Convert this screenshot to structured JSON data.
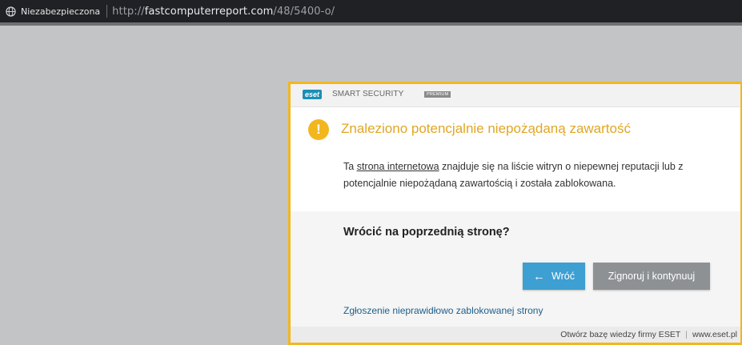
{
  "browser": {
    "security_label": "Niezabezpieczona",
    "url_prefix": "http://",
    "url_host": "fastcomputerreport.com",
    "url_path": "/48/5400-o/"
  },
  "eset": {
    "logo": "eset",
    "product": "SMART SECURITY",
    "edition": "PREMIUM",
    "title": "Znaleziono potencjalnie niepożądaną zawartość",
    "message_before": "Ta ",
    "message_link": "strona internetowa",
    "message_after": " znajduje się na liście witryn o niepewnej reputacji lub z potencjalnie niepożądaną zawartością i została zablokowana.",
    "question": "Wrócić na poprzednią stronę?",
    "back_label": "Wróć",
    "ignore_label": "Zignoruj i kontynuuj",
    "report_link": "Zgłoszenie nieprawidłowo zablokowanej strony",
    "footer_kb": "Otwórz bazę wiedzy firmy ESET",
    "footer_site": "www.eset.pl",
    "colors": {
      "accent": "#f2b71e",
      "title": "#e0a722",
      "primary_button": "#3e9fd2",
      "secondary_button": "#8e9194",
      "link": "#1d5e8a"
    }
  }
}
